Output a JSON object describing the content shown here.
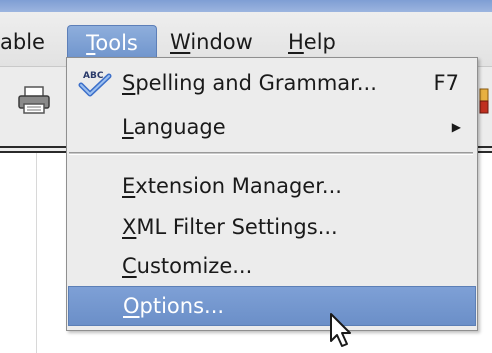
{
  "menubar": {
    "items": [
      {
        "label": "able",
        "mnemonic_prefix": "",
        "rest": "able"
      },
      {
        "label": "Tools",
        "mnemonic": "T",
        "rest": "ools"
      },
      {
        "label": "Window",
        "mnemonic": "W",
        "rest": "indow"
      },
      {
        "label": "Help",
        "mnemonic": "H",
        "rest": "elp"
      }
    ],
    "active": "Tools"
  },
  "tools_menu": {
    "items": [
      {
        "mnemonic": "S",
        "rest": "pelling and Grammar...",
        "shortcut": "F7",
        "icon": "spellcheck-icon"
      },
      {
        "mnemonic": "L",
        "rest": "anguage",
        "submenu": true
      },
      {
        "mnemonic": "E",
        "rest": "xtension Manager..."
      },
      {
        "mnemonic": "X",
        "rest": "ML Filter Settings..."
      },
      {
        "mnemonic": "C",
        "rest": "ustomize..."
      },
      {
        "mnemonic": "O",
        "rest": "ptions...",
        "highlighted": true
      }
    ],
    "spell_icon_text": "ABC"
  },
  "colors": {
    "highlight": "#7ea0d6",
    "menubar_bg": "#e6e6e6",
    "menu_bg": "#ececec"
  }
}
